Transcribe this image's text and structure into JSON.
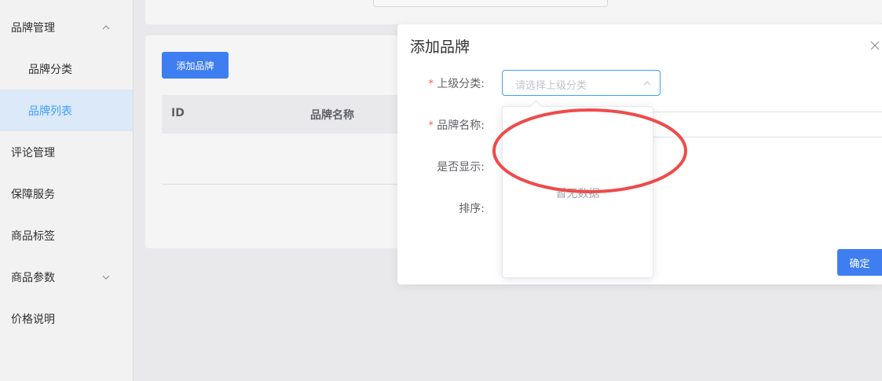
{
  "sidebar": {
    "items": [
      {
        "label": "品牌管理",
        "expanded": true
      },
      {
        "label": "品牌分类"
      },
      {
        "label": "品牌列表",
        "active": true
      },
      {
        "label": "评论管理"
      },
      {
        "label": "保障服务"
      },
      {
        "label": "商品标签"
      },
      {
        "label": "商品参数",
        "expanded": false
      },
      {
        "label": "价格说明"
      }
    ]
  },
  "main": {
    "add_button_label": "添加品牌",
    "table": {
      "columns": [
        "ID",
        "品牌名称"
      ]
    }
  },
  "dialog": {
    "title": "添加品牌",
    "fields": {
      "parent_category": {
        "label": "上级分类:",
        "required": true,
        "placeholder": "请选择上级分类",
        "empty_text": "暂无数据"
      },
      "brand_name": {
        "label": "品牌名称:",
        "required": true,
        "value": ""
      },
      "show": {
        "label": "是否显示:"
      },
      "sort": {
        "label": "排序:"
      }
    },
    "confirm_label": "确定"
  },
  "annotation": {
    "shape": "ellipse",
    "color": "#ef4b4b"
  },
  "colors": {
    "primary": "#3f7ef0",
    "active_text": "#409eff",
    "active_bg": "#dbe9f8",
    "required": "#f56c6c"
  }
}
